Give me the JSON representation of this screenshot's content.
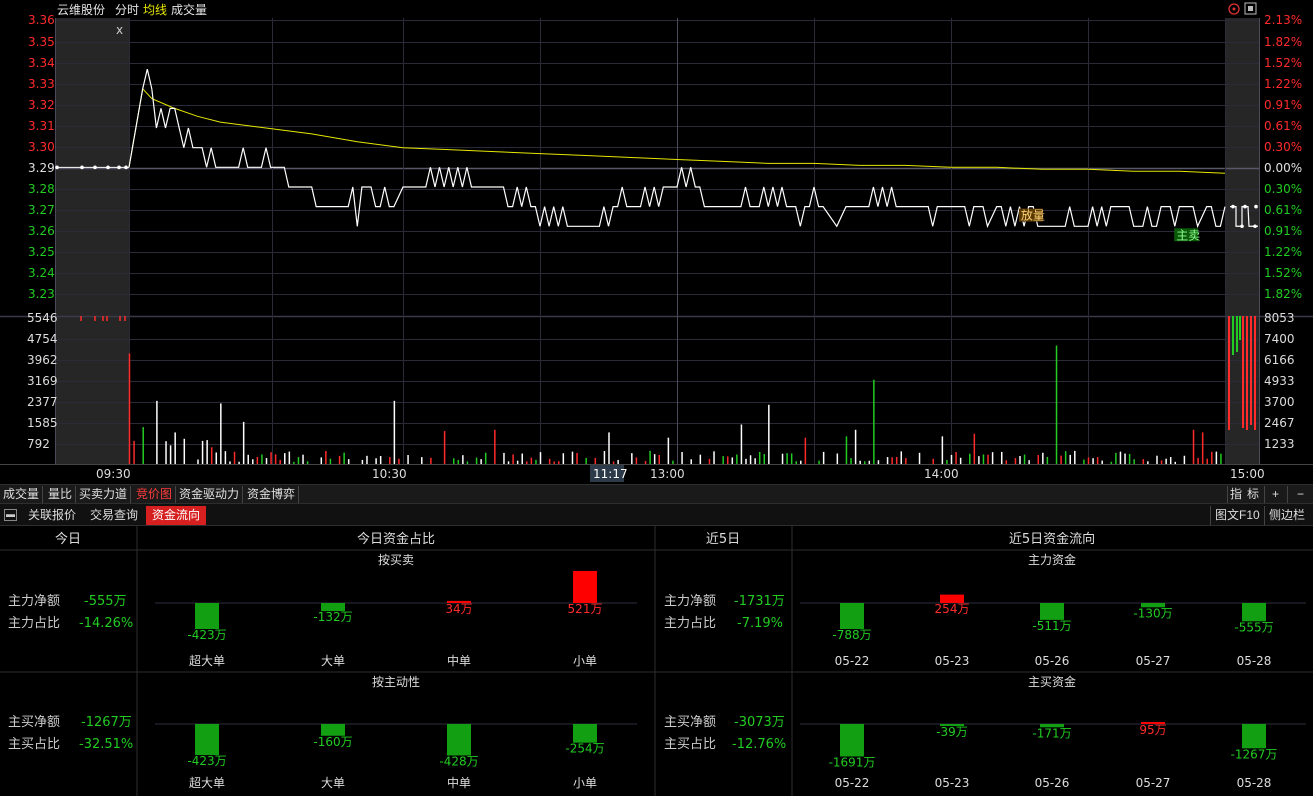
{
  "header": {
    "stock_name": "云维股份",
    "tab_fenshi": "分时",
    "tab_junxian": "均线",
    "tab_volume": "成交量",
    "close_icon": "x"
  },
  "price_axis": {
    "left_labels": [
      "3.36",
      "3.35",
      "3.34",
      "3.33",
      "3.32",
      "3.31",
      "3.30",
      "3.29",
      "3.28",
      "3.27",
      "3.26",
      "3.25",
      "3.24",
      "3.23"
    ],
    "right_labels": [
      "2.13%",
      "1.82%",
      "1.52%",
      "1.22%",
      "0.91%",
      "0.61%",
      "0.30%",
      "0.00%",
      "0.30%",
      "0.61%",
      "0.91%",
      "1.22%",
      "1.52%",
      "1.82%"
    ]
  },
  "volume_axis": {
    "left_labels": [
      "5546",
      "4754",
      "3962",
      "3169",
      "2377",
      "1585",
      "792"
    ],
    "right_labels": [
      "8053",
      "7400",
      "6166",
      "4933",
      "3700",
      "2467",
      "1233"
    ]
  },
  "time_axis": {
    "labels": [
      "09:30",
      "10:30",
      "13:00",
      "14:00",
      "15:00"
    ],
    "cursor_time": "11:17"
  },
  "chart_data": {
    "type": "line",
    "prev_close": 3.29,
    "ylim": [
      3.225,
      3.365
    ],
    "price_series": [
      [
        0,
        3.29
      ],
      [
        3,
        3.33
      ],
      [
        4,
        3.34
      ],
      [
        5,
        3.33
      ],
      [
        6,
        3.31
      ],
      [
        7,
        3.32
      ],
      [
        8,
        3.31
      ],
      [
        9,
        3.32
      ],
      [
        10,
        3.32
      ],
      [
        11,
        3.31
      ],
      [
        12,
        3.3
      ],
      [
        13,
        3.31
      ],
      [
        14,
        3.3
      ],
      [
        16,
        3.3
      ],
      [
        17,
        3.29
      ],
      [
        18,
        3.3
      ],
      [
        19,
        3.29
      ],
      [
        20,
        3.29
      ],
      [
        24,
        3.29
      ],
      [
        25,
        3.3
      ],
      [
        26,
        3.29
      ],
      [
        29,
        3.29
      ],
      [
        30,
        3.3
      ],
      [
        31,
        3.29
      ],
      [
        32,
        3.29
      ],
      [
        34,
        3.29
      ],
      [
        35,
        3.28
      ],
      [
        40,
        3.28
      ],
      [
        41,
        3.27
      ],
      [
        48,
        3.27
      ],
      [
        49,
        3.28
      ],
      [
        50,
        3.26
      ],
      [
        51,
        3.28
      ],
      [
        53,
        3.28
      ],
      [
        54,
        3.27
      ],
      [
        55,
        3.27
      ],
      [
        56,
        3.28
      ],
      [
        57,
        3.27
      ],
      [
        58,
        3.27
      ],
      [
        60,
        3.28
      ],
      [
        61,
        3.28
      ],
      [
        62,
        3.28
      ],
      [
        63,
        3.28
      ],
      [
        64,
        3.28
      ],
      [
        65,
        3.28
      ],
      [
        66,
        3.29
      ],
      [
        67,
        3.28
      ],
      [
        68,
        3.29
      ],
      [
        69,
        3.28
      ],
      [
        70,
        3.29
      ],
      [
        71,
        3.28
      ],
      [
        72,
        3.29
      ],
      [
        73,
        3.28
      ],
      [
        74,
        3.29
      ],
      [
        75,
        3.28
      ],
      [
        78,
        3.28
      ],
      [
        79,
        3.28
      ],
      [
        82,
        3.28
      ],
      [
        83,
        3.27
      ],
      [
        84,
        3.27
      ],
      [
        85,
        3.28
      ],
      [
        86,
        3.27
      ],
      [
        87,
        3.28
      ],
      [
        88,
        3.27
      ],
      [
        89,
        3.27
      ],
      [
        90,
        3.26
      ],
      [
        91,
        3.27
      ],
      [
        92,
        3.26
      ],
      [
        93,
        3.27
      ],
      [
        94,
        3.26
      ],
      [
        95,
        3.27
      ],
      [
        96,
        3.26
      ],
      [
        100,
        3.26
      ],
      [
        103,
        3.26
      ],
      [
        104,
        3.27
      ],
      [
        105,
        3.26
      ],
      [
        106,
        3.27
      ],
      [
        107,
        3.27
      ],
      [
        108,
        3.28
      ],
      [
        109,
        3.27
      ],
      [
        110,
        3.27
      ],
      [
        112,
        3.27
      ],
      [
        113,
        3.28
      ],
      [
        114,
        3.27
      ],
      [
        115,
        3.28
      ],
      [
        116,
        3.27
      ],
      [
        117,
        3.28
      ],
      [
        120,
        3.28
      ],
      [
        121,
        3.29
      ],
      [
        122,
        3.28
      ],
      [
        123,
        3.29
      ],
      [
        124,
        3.28
      ],
      [
        125,
        3.28
      ],
      [
        126,
        3.27
      ],
      [
        130,
        3.27
      ],
      [
        134,
        3.27
      ],
      [
        135,
        3.28
      ],
      [
        136,
        3.27
      ],
      [
        138,
        3.27
      ],
      [
        139,
        3.28
      ],
      [
        140,
        3.27
      ],
      [
        141,
        3.28
      ],
      [
        142,
        3.27
      ],
      [
        143,
        3.28
      ],
      [
        144,
        3.27
      ],
      [
        146,
        3.27
      ],
      [
        147,
        3.26
      ],
      [
        148,
        3.27
      ],
      [
        149,
        3.27
      ],
      [
        150,
        3.28
      ],
      [
        151,
        3.27
      ],
      [
        152,
        3.27
      ],
      [
        155,
        3.26
      ],
      [
        157,
        3.27
      ],
      [
        162,
        3.27
      ],
      [
        163,
        3.28
      ],
      [
        164,
        3.27
      ],
      [
        165,
        3.28
      ],
      [
        166,
        3.27
      ],
      [
        167,
        3.28
      ],
      [
        168,
        3.27
      ],
      [
        170,
        3.27
      ],
      [
        175,
        3.27
      ],
      [
        176,
        3.26
      ],
      [
        177,
        3.27
      ],
      [
        178,
        3.27
      ],
      [
        180,
        3.27
      ],
      [
        183,
        3.27
      ],
      [
        184,
        3.26
      ],
      [
        185,
        3.27
      ],
      [
        187,
        3.27
      ],
      [
        188,
        3.26
      ],
      [
        190,
        3.27
      ],
      [
        191,
        3.27
      ],
      [
        192,
        3.26
      ],
      [
        193,
        3.27
      ],
      [
        194,
        3.26
      ],
      [
        195,
        3.27
      ],
      [
        196,
        3.26
      ],
      [
        197,
        3.27
      ],
      [
        198,
        3.27
      ],
      [
        199,
        3.26
      ],
      [
        205,
        3.26
      ],
      [
        206,
        3.27
      ],
      [
        207,
        3.26
      ],
      [
        210,
        3.26
      ],
      [
        211,
        3.27
      ],
      [
        212,
        3.26
      ],
      [
        213,
        3.27
      ],
      [
        214,
        3.26
      ],
      [
        215,
        3.27
      ],
      [
        218,
        3.27
      ],
      [
        219,
        3.27
      ],
      [
        220,
        3.26
      ],
      [
        222,
        3.26
      ],
      [
        223,
        3.27
      ],
      [
        224,
        3.26
      ],
      [
        225,
        3.26
      ],
      [
        226,
        3.27
      ],
      [
        228,
        3.27
      ],
      [
        229,
        3.26
      ],
      [
        230,
        3.27
      ],
      [
        233,
        3.27
      ],
      [
        234,
        3.26
      ],
      [
        236,
        3.27
      ],
      [
        237,
        3.27
      ],
      [
        238,
        3.26
      ],
      [
        239,
        3.26
      ],
      [
        240,
        3.27
      ]
    ],
    "avg_series": [
      [
        0,
        3.29
      ],
      [
        3,
        3.33
      ],
      [
        5,
        3.325
      ],
      [
        8,
        3.322
      ],
      [
        10,
        3.32
      ],
      [
        15,
        3.316
      ],
      [
        20,
        3.313
      ],
      [
        30,
        3.31
      ],
      [
        40,
        3.307
      ],
      [
        50,
        3.303
      ],
      [
        60,
        3.3
      ],
      [
        70,
        3.299
      ],
      [
        80,
        3.298
      ],
      [
        90,
        3.297
      ],
      [
        100,
        3.296
      ],
      [
        110,
        3.295
      ],
      [
        120,
        3.294
      ],
      [
        130,
        3.293
      ],
      [
        140,
        3.292
      ],
      [
        150,
        3.292
      ],
      [
        160,
        3.291
      ],
      [
        170,
        3.291
      ],
      [
        180,
        3.29
      ],
      [
        190,
        3.29
      ],
      [
        200,
        3.289
      ],
      [
        210,
        3.289
      ],
      [
        220,
        3.288
      ],
      [
        230,
        3.288
      ],
      [
        240,
        3.287
      ]
    ],
    "marker_labels": [
      {
        "text": "放量",
        "t": 194,
        "p": 3.27
      },
      {
        "text": "主卖",
        "t": 228,
        "p": 3.26
      }
    ],
    "volume_max": 5546
  },
  "bottom_tabs": {
    "items": [
      "成交量",
      "量比",
      "买卖力道",
      "竞价图",
      "资金驱动力",
      "资金博弈"
    ],
    "right": [
      "指",
      "标",
      "+",
      "−"
    ]
  },
  "panel_tabs": {
    "items": [
      "关联报价",
      "交易查询",
      "资金流向"
    ],
    "right": [
      "图文F10",
      "侧边栏"
    ]
  },
  "today": {
    "title": "今日",
    "main_net_label": "主力净额",
    "main_net": "-555万",
    "main_ratio_label": "主力占比",
    "main_ratio": "-14.26%",
    "buy_net_label": "主买净额",
    "buy_net": "-1267万",
    "buy_ratio_label": "主买占比",
    "buy_ratio": "-32.51%"
  },
  "today_ratio": {
    "title": "今日资金占比",
    "sub1": "按买卖",
    "sub2": "按主动性",
    "categories": [
      "超大单",
      "大单",
      "中单",
      "小单"
    ],
    "by_trade": [
      {
        "v": -423,
        "label": "-423万"
      },
      {
        "v": -132,
        "label": "-132万"
      },
      {
        "v": 34,
        "label": "34万"
      },
      {
        "v": 521,
        "label": "521万"
      }
    ],
    "by_active": [
      {
        "v": -423,
        "label": "-423万"
      },
      {
        "v": -160,
        "label": "-160万"
      },
      {
        "v": -428,
        "label": "-428万"
      },
      {
        "v": -254,
        "label": "-254万"
      }
    ]
  },
  "five_days": {
    "title": "近5日",
    "main_net_label": "主力净额",
    "main_net": "-1731万",
    "main_ratio_label": "主力占比",
    "main_ratio": "-7.19%",
    "buy_net_label": "主买净额",
    "buy_net": "-3073万",
    "buy_ratio_label": "主买占比",
    "buy_ratio": "-12.76%"
  },
  "five_flow": {
    "title": "近5日资金流向",
    "sub1": "主力资金",
    "sub2": "主买资金",
    "dates": [
      "05-22",
      "05-23",
      "05-26",
      "05-27",
      "05-28"
    ],
    "main": [
      {
        "v": -788,
        "label": "-788万"
      },
      {
        "v": 254,
        "label": "254万"
      },
      {
        "v": -511,
        "label": "-511万"
      },
      {
        "v": -130,
        "label": "-130万"
      },
      {
        "v": -555,
        "label": "-555万"
      }
    ],
    "active": [
      {
        "v": -1691,
        "label": "-1691万"
      },
      {
        "v": -39,
        "label": "-39万"
      },
      {
        "v": -171,
        "label": "-171万"
      },
      {
        "v": 95,
        "label": "95万"
      },
      {
        "v": -1267,
        "label": "-1267万"
      }
    ]
  },
  "colors": {
    "up": "#ff2b2b",
    "down": "#00c000",
    "bar_down": "#12a012",
    "bar_up": "#ff0000",
    "line": "#ffffff",
    "avg": "#e6e600",
    "grid": "#2a2a38"
  }
}
